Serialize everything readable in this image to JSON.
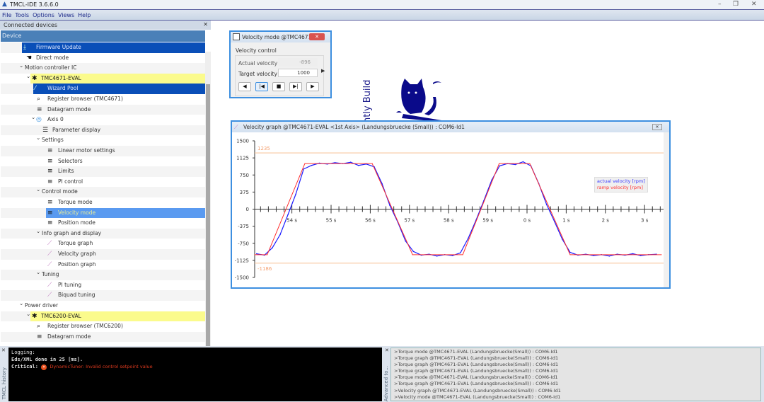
{
  "app": {
    "title": "TMCL-IDE 3.6.6.0",
    "logo_icon": "triangle-logo-icon"
  },
  "menu": [
    "File",
    "Tools",
    "Options",
    "Views",
    "Help"
  ],
  "left": {
    "panel_title": "Connected devices",
    "column_header": "Device",
    "tree": [
      {
        "label": "Firmware Update",
        "icon": "download-icon",
        "state": "selected"
      },
      {
        "label": "Direct mode",
        "icon": "hand-pointer-icon"
      },
      {
        "label": "Motion controller IC",
        "chevron": true
      },
      {
        "label": "TMC4671-EVAL",
        "icon": "puzzle-icon",
        "chevron": true,
        "state": "device"
      },
      {
        "label": "Wizard Pool",
        "icon": "wand-icon",
        "state": "selected"
      },
      {
        "label": "Register browser (TMC4671)",
        "icon": "magnifier-icon"
      },
      {
        "label": "Datagram mode",
        "icon": "sliders-icon"
      },
      {
        "label": "Axis 0",
        "icon": "axis-icon",
        "chevron": true
      },
      {
        "label": "Parameter display",
        "icon": "list-icon"
      },
      {
        "label": "Settings",
        "chevron": true
      },
      {
        "label": "Linear motor settings",
        "icon": "sliders-icon"
      },
      {
        "label": "Selectors",
        "icon": "sliders-icon"
      },
      {
        "label": "Limits",
        "icon": "sliders-icon"
      },
      {
        "label": "PI control",
        "icon": "sliders-icon"
      },
      {
        "label": "Control mode",
        "chevron": true
      },
      {
        "label": "Torque mode",
        "icon": "sliders-icon"
      },
      {
        "label": "Velocity mode",
        "icon": "sliders-icon",
        "state": "active"
      },
      {
        "label": "Position mode",
        "icon": "sliders-icon"
      },
      {
        "label": "Info graph and display",
        "chevron": true
      },
      {
        "label": "Torque graph",
        "icon": "graph-icon"
      },
      {
        "label": "Velocity graph",
        "icon": "graph-icon"
      },
      {
        "label": "Position graph",
        "icon": "graph-icon"
      },
      {
        "label": "Tuning",
        "chevron": true
      },
      {
        "label": "PI tuning",
        "icon": "graph-icon"
      },
      {
        "label": "Biquad tuning",
        "icon": "graph-icon"
      },
      {
        "label": "Power driver",
        "chevron": true
      },
      {
        "label": "TMC6200-EVAL",
        "icon": "puzzle-icon",
        "chevron": true,
        "state": "device"
      },
      {
        "label": "Register browser (TMC6200)",
        "icon": "magnifier-icon"
      },
      {
        "label": "Datagram mode",
        "icon": "sliders-icon"
      }
    ]
  },
  "velocity_mode": {
    "title": "Velocity mode @TMC4671-EV...",
    "group": "Velocity control",
    "actual_label": "Actual velocity",
    "actual_value": "-896",
    "target_label": "Target velocity",
    "target_value": "1000",
    "buttons": [
      "rotate-left-icon",
      "skip-start-icon",
      "stop-icon",
      "skip-end-icon",
      "rotate-right-icon"
    ]
  },
  "watermark": {
    "text": "ntly Build"
  },
  "velocity_graph": {
    "title": "Velocity graph @TMC4671-EVAL <1st Axis> (Landungsbruecke (Small)) : COM6-Id1"
  },
  "chart_data": {
    "type": "line",
    "ylim": [
      -1500,
      1500
    ],
    "yticks": [
      1500,
      1125,
      750,
      375,
      0,
      -375,
      -750,
      -1125,
      -1500
    ],
    "xlim": [
      53.05,
      63.43
    ],
    "xticks": [
      {
        "v": 54,
        "label": "54 s"
      },
      {
        "v": 55,
        "label": "55 s"
      },
      {
        "v": 56,
        "label": "56 s"
      },
      {
        "v": 57,
        "label": "57 s"
      },
      {
        "v": 58,
        "label": "58 s"
      },
      {
        "v": 59,
        "label": "59 s"
      },
      {
        "v": 60,
        "label": "0 s"
      },
      {
        "v": 61,
        "label": "1 s"
      },
      {
        "v": 62,
        "label": "2 s"
      },
      {
        "v": 63,
        "label": "3 s"
      }
    ],
    "limits": [
      {
        "value": 1235,
        "label": "1235"
      },
      {
        "value": -1186,
        "label": "-1186"
      }
    ],
    "legend_position": "right",
    "series": [
      {
        "name": "actual velocity [rpm]",
        "color": "#1a1aff",
        "x": [
          53.1,
          53.3,
          53.5,
          53.7,
          53.9,
          54.1,
          54.3,
          54.5,
          54.7,
          54.9,
          55.1,
          55.3,
          55.5,
          55.7,
          55.9,
          56.1,
          56.3,
          56.5,
          56.7,
          56.9,
          57.1,
          57.3,
          57.5,
          57.7,
          57.9,
          58.1,
          58.3,
          58.5,
          58.7,
          58.9,
          59.1,
          59.3,
          59.5,
          59.7,
          59.9,
          60.1,
          60.3,
          60.5,
          60.7,
          60.9,
          61.1,
          61.3,
          61.5,
          61.7,
          61.9,
          62.1,
          62.3,
          62.5,
          62.7,
          62.9,
          63.1,
          63.3
        ],
        "y": [
          -980,
          -1010,
          -850,
          -560,
          -120,
          330,
          880,
          960,
          1010,
          990,
          1020,
          1000,
          1030,
          960,
          990,
          930,
          560,
          80,
          -280,
          -700,
          -930,
          -1010,
          -990,
          -1030,
          -1000,
          -1020,
          -960,
          -640,
          -240,
          190,
          640,
          950,
          1000,
          980,
          1040,
          950,
          560,
          100,
          -270,
          -660,
          -950,
          -1010,
          -990,
          -1020,
          -1000,
          -1030,
          -990,
          -1010,
          -980,
          -1020,
          -1000,
          -990
        ]
      },
      {
        "name": "ramp velocity [rpm]",
        "color": "#ff3030",
        "x": [
          53.05,
          53.37,
          54.33,
          56.05,
          57.08,
          58.36,
          59.29,
          60.07,
          61.1,
          63.43
        ],
        "y": [
          -1000,
          -1000,
          1000,
          1000,
          -1000,
          -1000,
          1000,
          1000,
          -1000,
          -1000
        ]
      }
    ]
  },
  "log": {
    "side_label": "TMCL history",
    "lines": [
      "Logging:",
      "Eds/XML done in 25 [ms]."
    ],
    "critical_label": "Critical:",
    "critical_msg": "DynamicTuner: Invalid control setpoint value"
  },
  "advanced": {
    "side_label": "Advanced to...",
    "lines": [
      ">Torque mode @TMC4671-EVAL (Landungsbruecke(Small)) : COM6-Id1",
      ">Torque graph @TMC4671-EVAL (Landungsbruecke(Small)) : COM6-Id1",
      ">Torque graph @TMC4671-EVAL (Landungsbruecke(Small)) : COM6-Id1",
      ">Torque graph @TMC4671-EVAL (Landungsbruecke(Small)) : COM6-Id1",
      ">Torque mode @TMC4671-EVAL (Landungsbruecke(Small)) : COM6-Id1",
      ">Torque graph @TMC4671-EVAL (Landungsbruecke(Small)) : COM6-Id1",
      ">Velocity graph @TMC4671-EVAL (Landungsbruecke(Small)) : COM6-Id1",
      ">Velocity mode @TMC4671-EVAL (Landungsbruecke(Small)) : COM6-Id1"
    ]
  }
}
